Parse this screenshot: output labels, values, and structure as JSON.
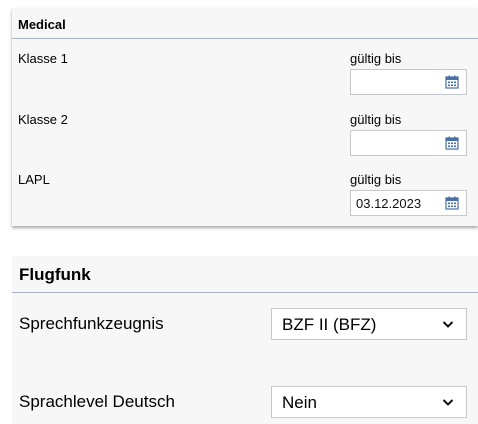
{
  "medical": {
    "title": "Medical",
    "rows": [
      {
        "label": "Klasse 1",
        "valid_label": "gültig bis",
        "date": ""
      },
      {
        "label": "Klasse 2",
        "valid_label": "gültig bis",
        "date": ""
      },
      {
        "label": "LAPL",
        "valid_label": "gültig bis",
        "date": "03.12.2023"
      }
    ],
    "icon": "calendar-icon"
  },
  "flugfunk": {
    "title": "Flugfunk",
    "rows": [
      {
        "label": "Sprechfunkzeugnis",
        "selected": "BZF II (BFZ)"
      },
      {
        "label": "Sprachlevel Deutsch",
        "selected": "Nein"
      }
    ],
    "icon": "chevron-down-icon"
  },
  "colors": {
    "panel_bg": "#f7f7f7",
    "divider": "#a9b3c4",
    "icon_blue": "#4a6fa5"
  }
}
